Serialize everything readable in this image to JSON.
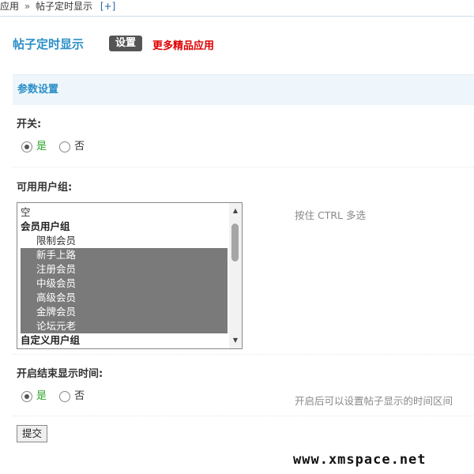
{
  "breadcrumb": {
    "root": "应用",
    "sep": "»",
    "current": "帖子定时显示",
    "add": "[+]"
  },
  "header": {
    "title": "帖子定时显示",
    "settings_badge": "设置",
    "more_link": "更多精品应用"
  },
  "section": {
    "title": "参数设置"
  },
  "switch": {
    "label": "开关:",
    "yes": "是",
    "no": "否",
    "selected": "yes"
  },
  "user_groups": {
    "label": "可用用户组:",
    "hint": "按住 CTRL 多选",
    "items": [
      {
        "text": "空"
      },
      {
        "text": "会员用户组"
      },
      {
        "text": "限制会员"
      },
      {
        "text": "新手上路"
      },
      {
        "text": "注册会员"
      },
      {
        "text": "中级会员"
      },
      {
        "text": "高级会员"
      },
      {
        "text": "金牌会员"
      },
      {
        "text": "论坛元老"
      },
      {
        "text": "自定义用户组"
      }
    ]
  },
  "time_range": {
    "label": "开启结束显示时间:",
    "yes": "是",
    "no": "否",
    "selected": "yes",
    "hint": "开启后可以设置帖子显示的时间区间"
  },
  "submit": {
    "label": "提交"
  },
  "watermark": "www.xmspace.net",
  "colors": {
    "title_blue": "#2b8fc8",
    "link_red": "#e00000",
    "badge_gray": "#555555",
    "yes_green": "#2aa52a",
    "selected_gray": "#7a7a7a"
  }
}
